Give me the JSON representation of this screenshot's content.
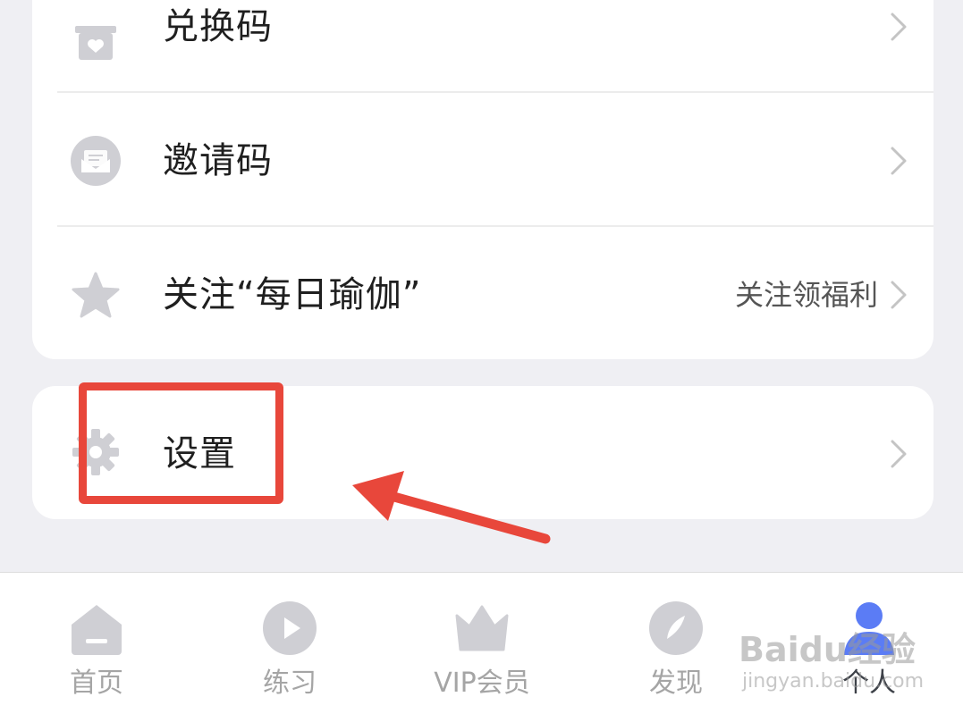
{
  "menu": {
    "items": [
      {
        "label": "兑换码",
        "icon": "gift-box-icon"
      },
      {
        "label": "邀请码",
        "icon": "envelope-icon"
      },
      {
        "label": "关注“每日瑜伽”",
        "icon": "star-icon",
        "hint": "关注领福利"
      }
    ],
    "settings": {
      "label": "设置",
      "icon": "gear-icon"
    }
  },
  "tabbar": {
    "tabs": [
      {
        "label": "首页",
        "icon": "home-icon"
      },
      {
        "label": "练习",
        "icon": "play-icon"
      },
      {
        "label": "VIP会员",
        "icon": "crown-icon"
      },
      {
        "label": "发现",
        "icon": "compass-icon"
      },
      {
        "label": "个人",
        "icon": "person-icon",
        "active": true
      }
    ]
  },
  "annotation": {
    "color": "#e8473b"
  },
  "watermark": {
    "main": "Baidu经验",
    "sub": "jingyan.baidu.com"
  },
  "colors": {
    "accent": "#5b7cf5",
    "icon_gray": "#cfcfd4",
    "background": "#efeff3"
  }
}
